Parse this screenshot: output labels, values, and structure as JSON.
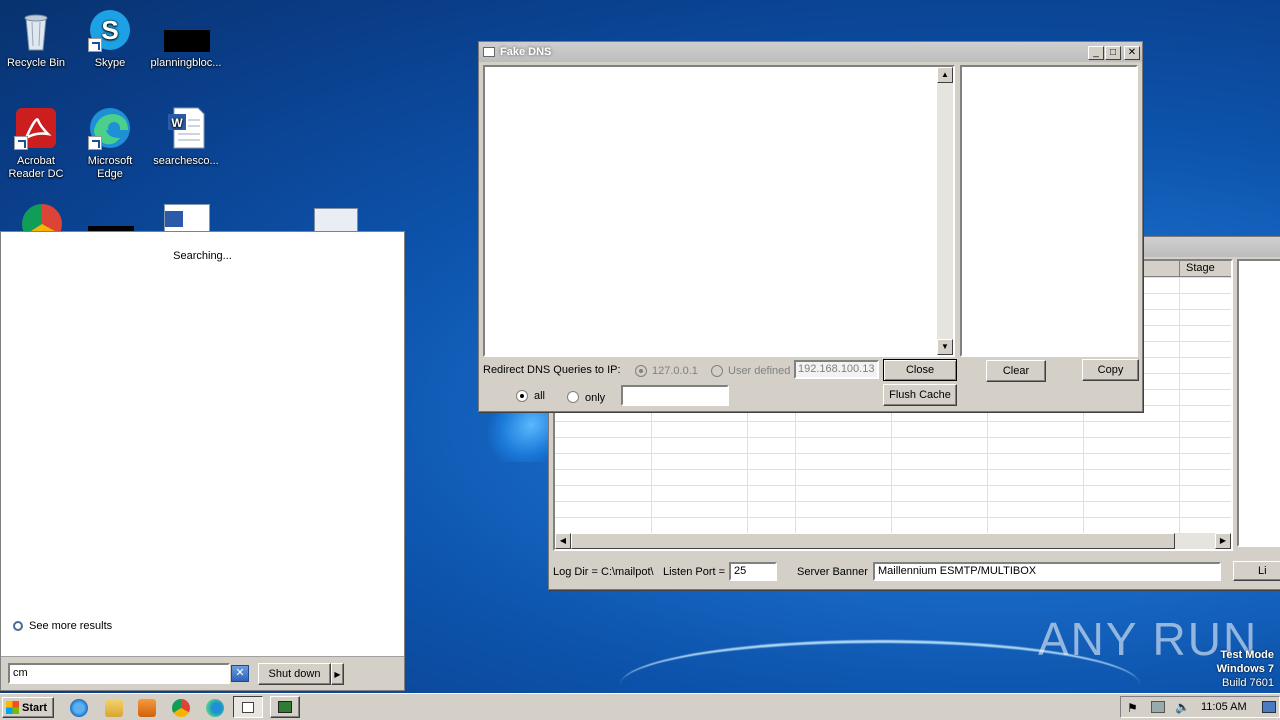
{
  "desktop": {
    "icons": [
      {
        "label": "Recycle Bin",
        "icon": "recycle-bin-icon"
      },
      {
        "label": "Skype",
        "icon": "skype-icon"
      },
      {
        "label": "planningbloc...",
        "icon": "file-icon"
      },
      {
        "label": "Acrobat Reader DC",
        "icon": "acrobat-icon"
      },
      {
        "label": "Microsoft Edge",
        "icon": "edge-icon"
      },
      {
        "label": "searchesco...",
        "icon": "word-doc-icon"
      }
    ]
  },
  "fake_dns": {
    "title": "Fake DNS",
    "redirect_label": "Redirect DNS Queries to IP:",
    "option_localhost": "127.0.0.1",
    "option_user_defined": "User defined",
    "user_ip_value": "192.168.100.13",
    "close_button": "Close",
    "flush_cache_button": "Flush Cache",
    "clear_button": "Clear",
    "copy_button": "Copy",
    "all_label": "all",
    "only_label": "only",
    "only_value": ""
  },
  "mailpot": {
    "stage_header": "Stage",
    "log_dir_label": "Log Dir = C:\\mailpot\\",
    "listen_port_label": "Listen Port =",
    "listen_port_value": "25",
    "server_banner_label": "Server Banner",
    "server_banner_value": "Maillennium ESMTP/MULTIBOX",
    "partial_button": "Li"
  },
  "start_menu": {
    "status": "Searching...",
    "see_more": "See more results",
    "search_value": "cm",
    "shutdown_button": "Shut down"
  },
  "taskbar": {
    "start_label": "Start",
    "clock": "11:05 AM"
  },
  "watermark": {
    "text": "ANY RUN",
    "test_mode": "Test Mode",
    "os_name": "Windows 7",
    "build": "Build 7601"
  }
}
